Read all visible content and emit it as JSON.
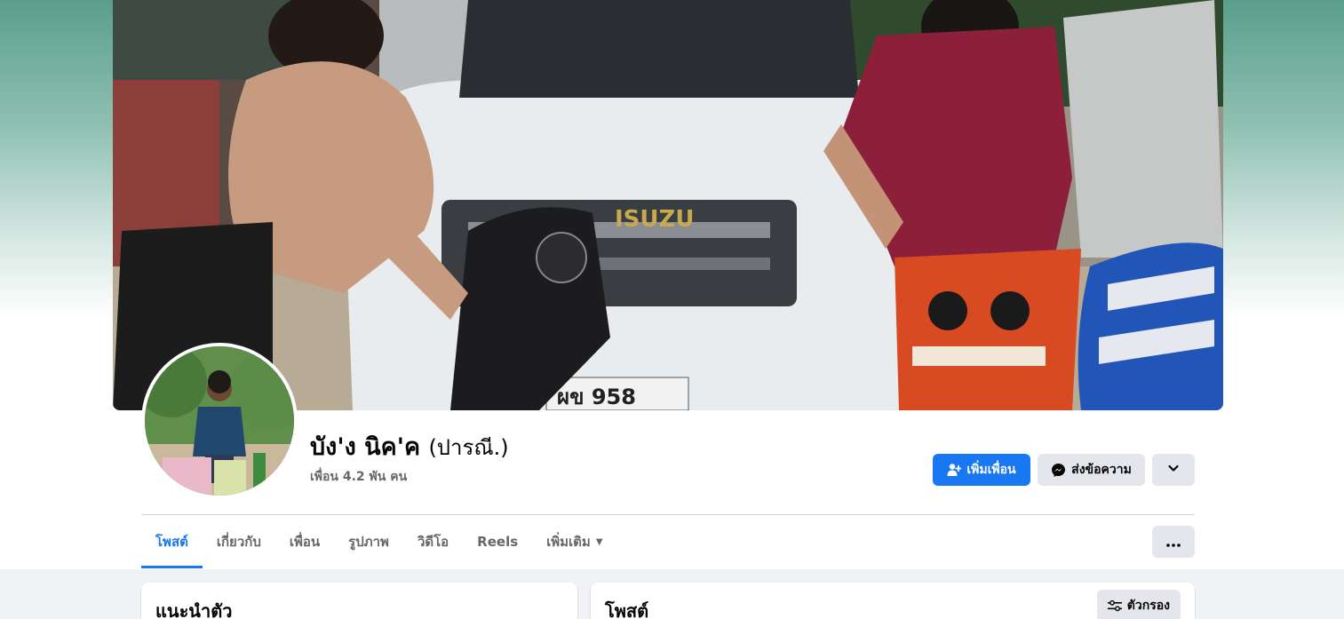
{
  "profile": {
    "name": "บัง'ง นิค'ค",
    "alternate_name": "(ปารณี.)",
    "friends_count": "เพื่อน 4.2 พัน คน"
  },
  "actions": {
    "add_friend": "เพิ่มเพื่อน",
    "message": "ส่งข้อความ",
    "dropdown_icon": "chevron-down-icon"
  },
  "tabs": [
    {
      "label": "โพสต์",
      "active": true
    },
    {
      "label": "เกี่ยวกับ",
      "active": false
    },
    {
      "label": "เพื่อน",
      "active": false
    },
    {
      "label": "รูปภาพ",
      "active": false
    },
    {
      "label": "วิดีโอ",
      "active": false
    },
    {
      "label": "Reels",
      "active": false
    },
    {
      "label": "เพิ่มเติม",
      "active": false
    }
  ],
  "more_options_icon": "ellipsis-icon",
  "intro_card": {
    "title": "แนะนำตัว"
  },
  "posts_card": {
    "title": "โพสต์",
    "filter_label": "ตัวกรอง"
  },
  "cover_photo": {
    "plate_text": "ผข 958",
    "grille_text": "ISUZU"
  },
  "colors": {
    "accent": "#1877f2",
    "button_gray": "#e4e6eb",
    "background": "#f0f2f5"
  }
}
